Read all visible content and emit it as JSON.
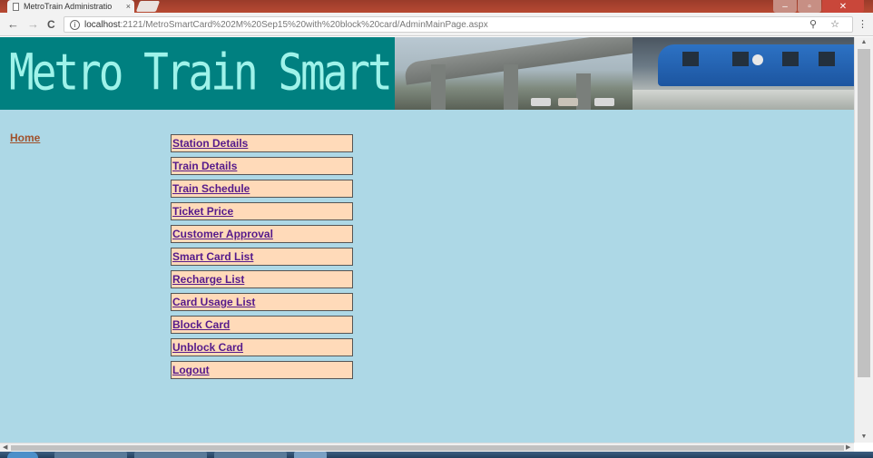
{
  "browser": {
    "tab_title": "MetroTrain Administratio",
    "tab_close": "×",
    "url_host": "localhost",
    "url_rest": ":2121/MetroSmartCard%202M%20Sep15%20with%20block%20card/AdminMainPage.aspx",
    "back": "←",
    "forward": "→",
    "reload": "C",
    "info": "i",
    "key_star": "⚲ ☆",
    "menu": "⋮",
    "min": "–",
    "max": "▫",
    "close": "✕"
  },
  "header": {
    "title": "Metro Train Smart Card"
  },
  "nav": {
    "home": "Home",
    "items": [
      "Station Details",
      "Train Details",
      "Train Schedule",
      "Ticket Price",
      "Customer Approval",
      "Smart Card List",
      "Recharge List",
      "Card Usage List",
      "Block Card",
      "Unblock Card",
      "Logout"
    ]
  },
  "colors": {
    "banner": "#008080",
    "banner_title": "#9ff3ea",
    "page_bg": "#add8e6",
    "menu_bg": "#ffdab9",
    "link": "#551a8b",
    "home_link": "#a0522d"
  },
  "scroll": {
    "up": "▲",
    "down": "▼",
    "left": "◀",
    "right": "▶"
  }
}
